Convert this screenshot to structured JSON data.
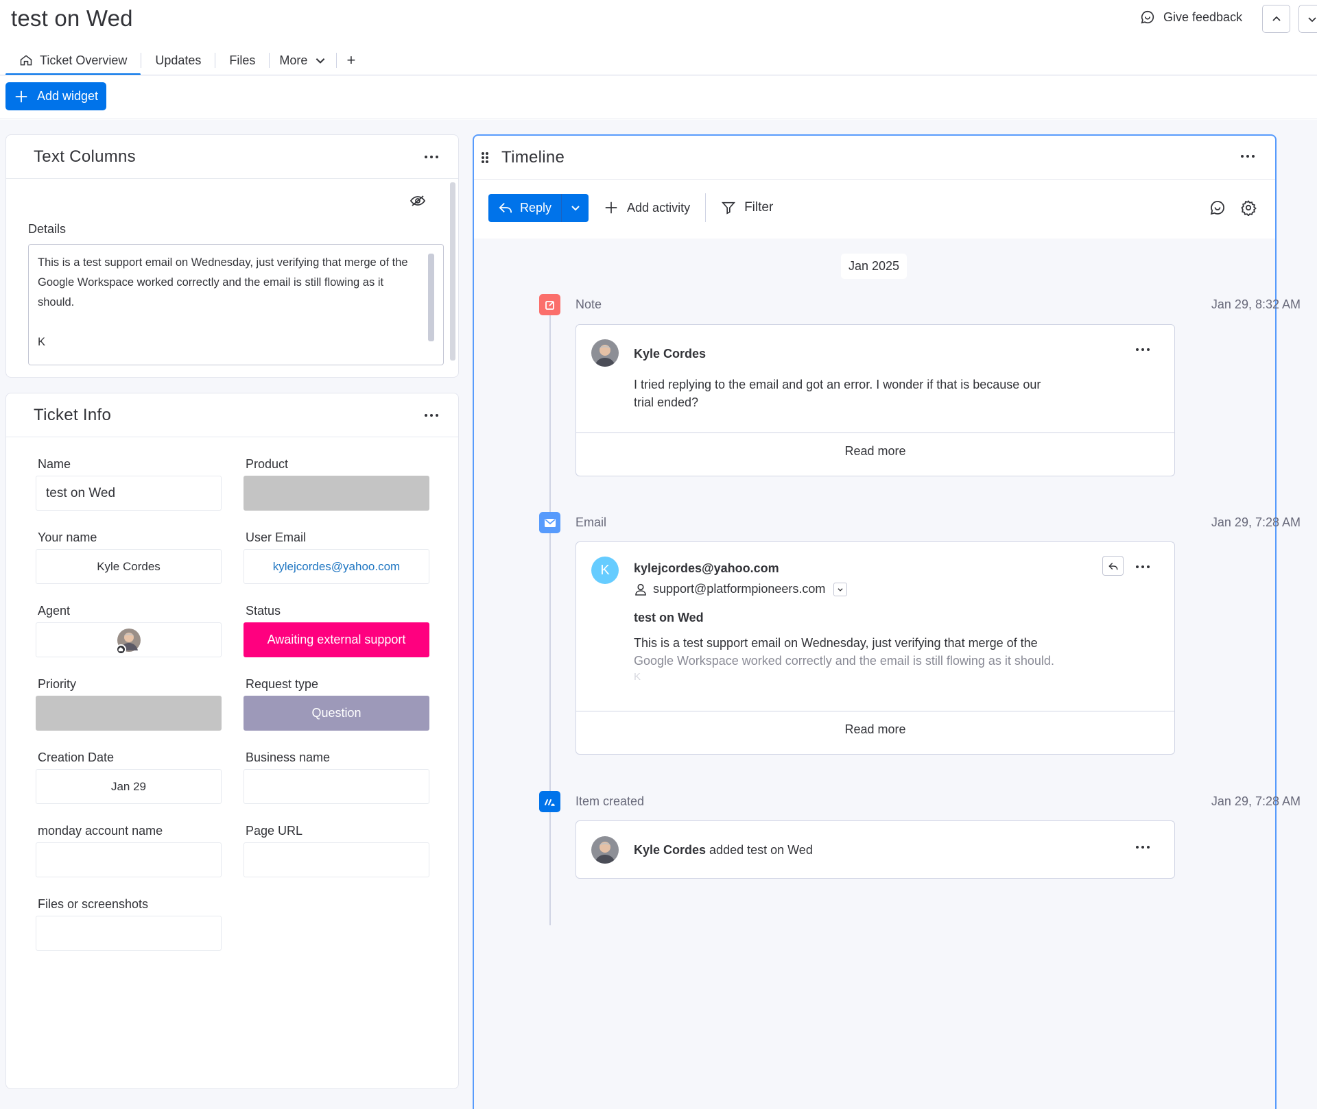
{
  "header": {
    "title": "test on Wed",
    "feedback_label": "Give feedback"
  },
  "tabs": [
    {
      "label": "Ticket Overview",
      "active": true
    },
    {
      "label": "Updates"
    },
    {
      "label": "Files"
    },
    {
      "label": "More"
    },
    {
      "label": "+"
    }
  ],
  "toolbar": {
    "add_widget_label": "Add widget"
  },
  "text_columns": {
    "title": "Text Columns",
    "details_label": "Details",
    "details_lines": [
      "This is a test support email on Wednesday, just verifying that merge of the",
      "Google Workspace worked correctly and the email is still flowing as it",
      "should.",
      "",
      "K"
    ]
  },
  "ticket_info": {
    "title": "Ticket Info",
    "fields": {
      "name": {
        "label": "Name",
        "value": "test on Wed"
      },
      "product": {
        "label": "Product",
        "value": ""
      },
      "your_name": {
        "label": "Your name",
        "value": "Kyle Cordes"
      },
      "user_email": {
        "label": "User Email",
        "value": "kylejcordes@yahoo.com"
      },
      "agent": {
        "label": "Agent"
      },
      "status": {
        "label": "Status",
        "value": "Awaiting external support"
      },
      "priority": {
        "label": "Priority",
        "value": ""
      },
      "request_type": {
        "label": "Request type",
        "value": "Question"
      },
      "creation_date": {
        "label": "Creation Date",
        "value": "Jan 29"
      },
      "business_name": {
        "label": "Business name",
        "value": ""
      },
      "monday_account": {
        "label": "monday account name",
        "value": ""
      },
      "page_url": {
        "label": "Page URL",
        "value": ""
      },
      "files": {
        "label": "Files or screenshots",
        "value": ""
      }
    }
  },
  "timeline": {
    "title": "Timeline",
    "reply_label": "Reply",
    "add_activity_label": "Add activity",
    "filter_label": "Filter",
    "month": "Jan 2025",
    "events": {
      "note": {
        "type": "Note",
        "time": "Jan 29, 8:32 AM",
        "author": "Kyle Cordes",
        "body_lines": [
          "I tried replying to the email and got an error. I wonder if that is because our",
          "trial ended?"
        ],
        "read_more": "Read more"
      },
      "email": {
        "type": "Email",
        "time": "Jan 29, 7:28 AM",
        "avatar_letter": "K",
        "from": "kylejcordes@yahoo.com",
        "to": "support@platformpioneers.com",
        "subject": "test on Wed",
        "body_lines": [
          "This is a test support email on Wednesday, just verifying that merge of the",
          "Google Workspace worked correctly and the email is still flowing as it should.",
          "K"
        ],
        "read_more": "Read more"
      },
      "created": {
        "type": "Item created",
        "time": "Jan 29, 7:28 AM",
        "author": "Kyle Cordes",
        "action": "added test on Wed"
      }
    }
  },
  "colors": {
    "accent": "#0073ea",
    "status_pink": "#ff007f",
    "request_purple": "#9d99b9",
    "note_icon": "#fb6f6b",
    "email_icon": "#579bfc",
    "created_icon": "#0073ea"
  }
}
